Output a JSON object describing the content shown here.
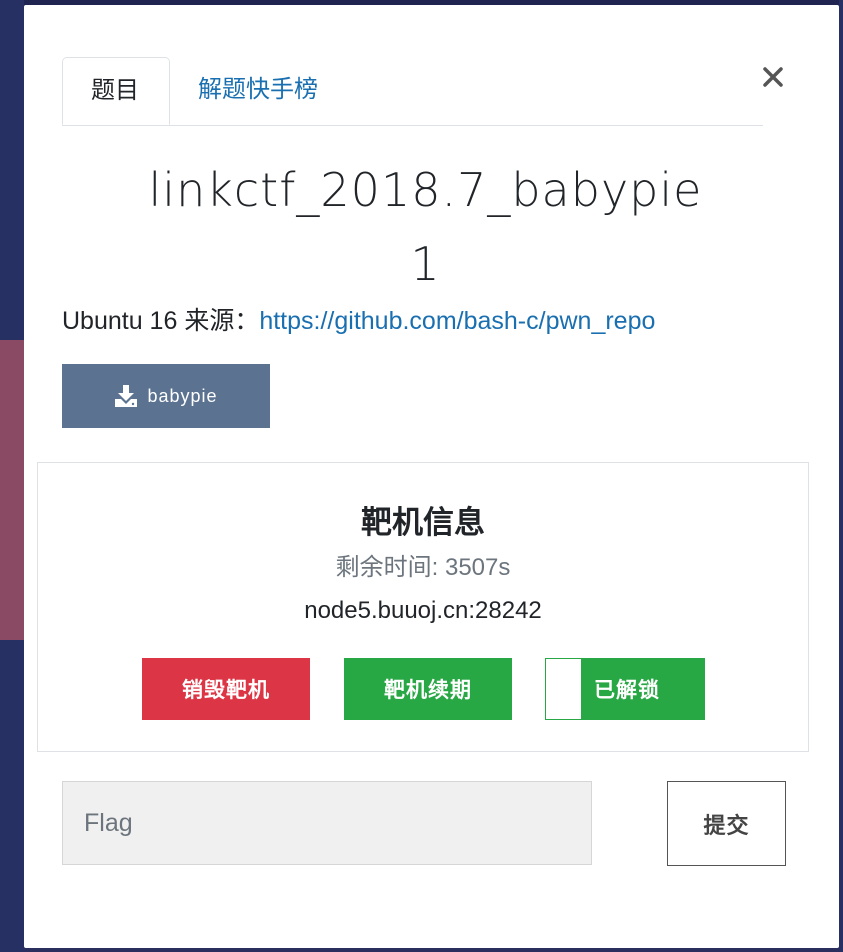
{
  "tabs": {
    "challenge": "题目",
    "leaderboard": "解题快手榜"
  },
  "close_symbol": "×",
  "challenge": {
    "title_line1": "linkctf_2018.7_babypie",
    "title_line2": "1",
    "source_prefix": "Ubuntu 16 来源：",
    "source_link": "https://github.com/bash-c/pwn_repo",
    "download_label": "babypie"
  },
  "machine": {
    "title": "靶机信息",
    "remaining_label": "剩余时间: ",
    "remaining_value": "3507s",
    "address": "node5.buuoj.cn:28242",
    "destroy_label": "销毁靶机",
    "renew_label": "靶机续期",
    "lock_label": "已解锁",
    "lock_state": "unlocked"
  },
  "flag": {
    "placeholder": "Flag",
    "value": "",
    "submit_label": "提交"
  },
  "colors": {
    "link": "#1a6fb0",
    "download_button": "#5b7291",
    "destroy_button": "#dc3545",
    "renew_button": "#28a745"
  }
}
